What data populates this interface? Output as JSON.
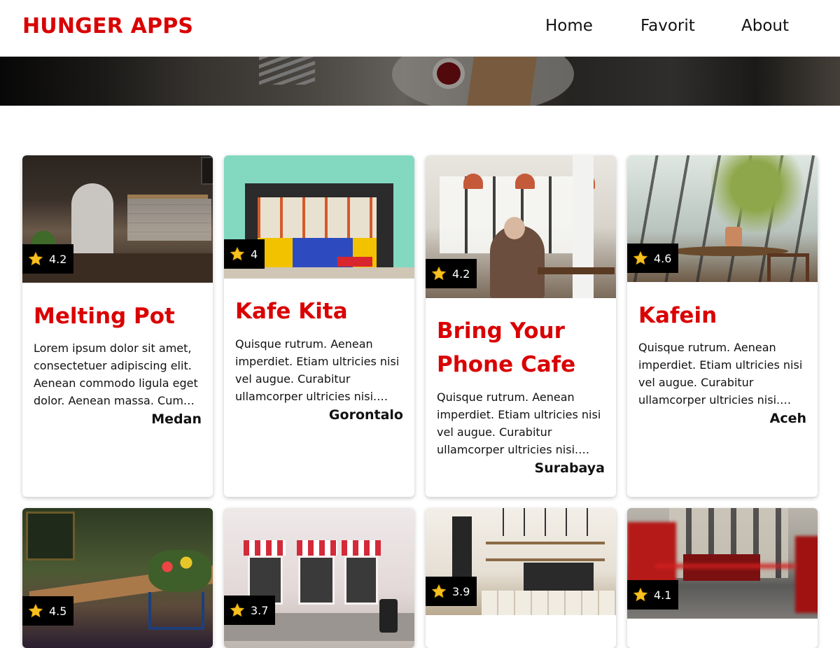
{
  "header": {
    "brand": "HUNGER APPS",
    "nav": [
      {
        "label": "Home"
      },
      {
        "label": "Favorit"
      },
      {
        "label": "About"
      }
    ]
  },
  "colors": {
    "brand": "#d90000",
    "text": "#111111",
    "rating_bg": "#000000",
    "star": "#f6c021"
  },
  "restaurants": [
    {
      "name": "Melting Pot",
      "rating": "4.2",
      "description": "Lorem ipsum dolor sit amet, consectetuer adipiscing elit. Aenean commodo ligula eget dolor. Aenean massa. Cum…",
      "city": "Medan"
    },
    {
      "name": "Kafe Kita",
      "rating": "4",
      "description": "Quisque rutrum. Aenean imperdiet. Etiam ultricies nisi vel augue. Curabitur ullamcorper ultricies nisi.…",
      "city": "Gorontalo"
    },
    {
      "name": "Bring Your Phone Cafe",
      "rating": "4.2",
      "description": "Quisque rutrum. Aenean imperdiet. Etiam ultricies nisi vel augue. Curabitur ullamcorper ultricies nisi.…",
      "city": "Surabaya"
    },
    {
      "name": "Kafein",
      "rating": "4.6",
      "description": "Quisque rutrum. Aenean imperdiet. Etiam ultricies nisi vel augue. Curabitur ullamcorper ultricies nisi.…",
      "city": "Aceh"
    },
    {
      "rating": "4.5"
    },
    {
      "rating": "3.7"
    },
    {
      "rating": "3.9"
    },
    {
      "rating": "4.1"
    }
  ]
}
